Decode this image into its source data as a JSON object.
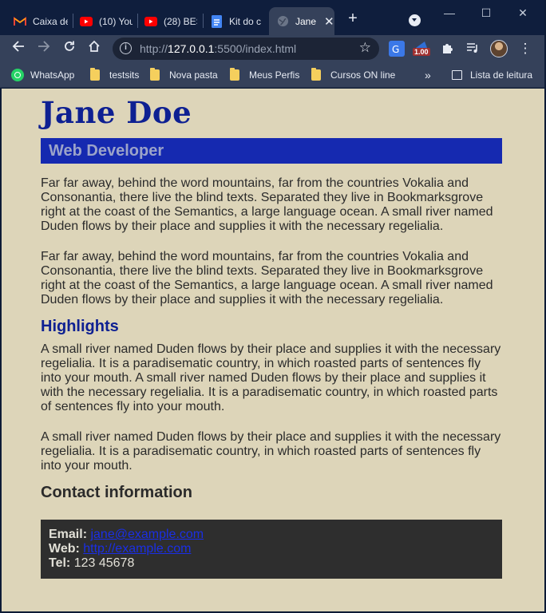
{
  "browser": {
    "tabs": [
      {
        "title": "Caixa de",
        "icon": "gmail-icon"
      },
      {
        "title": "(10) You",
        "icon": "youtube-icon"
      },
      {
        "title": "(28) BES",
        "icon": "youtube-icon"
      },
      {
        "title": "Kit do c",
        "icon": "docs-icon"
      },
      {
        "title": "Jane",
        "icon": "globe-icon",
        "active": true
      }
    ],
    "address": {
      "scheme": "http://",
      "host": "127.0.0.1",
      "rest": ":5500/index.html"
    },
    "extension_badge": "1.00",
    "bookmarks": [
      {
        "label": "WhatsApp",
        "type": "whatsapp"
      },
      {
        "label": "testsits",
        "type": "folder"
      },
      {
        "label": "Nova pasta",
        "type": "folder"
      },
      {
        "label": "Meus Perfis",
        "type": "folder"
      },
      {
        "label": "Cursos ON line",
        "type": "folder"
      }
    ],
    "reading_list": "Lista de leitura",
    "colors": {
      "tabbar": "#0f1e3d",
      "toolbar": "#35415a",
      "page_bg": "#ddd5b9"
    }
  },
  "page": {
    "name": "Jane Doe",
    "role": "Web Developer",
    "paragraphs_intro": [
      "Far far away, behind the word mountains, far from the countries Vokalia and Consonantia, there live the blind texts. Separated they live in Bookmarksgrove right at the coast of the Semantics, a large language ocean. A small river named Duden flows by their place and supplies it with the necessary regelialia.",
      "Far far away, behind the word mountains, far from the countries Vokalia and Consonantia, there live the blind texts. Separated they live in Bookmarksgrove right at the coast of the Semantics, a large language ocean. A small river named Duden flows by their place and supplies it with the necessary regelialia."
    ],
    "highlights_heading": "Highlights",
    "highlights": [
      "A small river named Duden flows by their place and supplies it with the necessary regelialia. It is a paradisematic country, in which roasted parts of sentences fly into your mouth. A small river named Duden flows by their place and supplies it with the necessary regelialia. It is a paradisematic country, in which roasted parts of sentences fly into your mouth.",
      "A small river named Duden flows by their place and supplies it with the necessary regelialia. It is a paradisematic country, in which roasted parts of sentences fly into your mouth."
    ],
    "contact_heading": "Contact information",
    "contact": {
      "email_label": "Email:",
      "email": "jane@example.com",
      "web_label": "Web:",
      "web": "http://example.com",
      "tel_label": "Tel:",
      "tel": "123 45678"
    },
    "colors": {
      "name": "#0e2092",
      "role_bar": "#1529b0",
      "contact_bg": "#2e2e2e",
      "link": "#1a2ee6"
    }
  }
}
